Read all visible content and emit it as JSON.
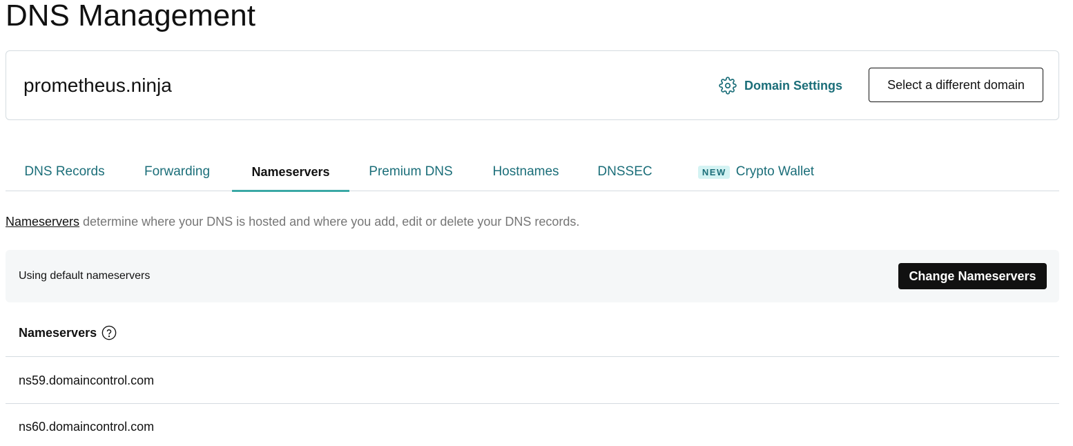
{
  "page": {
    "title": "DNS Management"
  },
  "domain_card": {
    "domain_name": "prometheus.ninja",
    "settings_label": "Domain Settings",
    "settings_icon": "gear-icon",
    "select_domain_label": "Select a different domain"
  },
  "tabs": [
    {
      "label": "DNS Records",
      "active": false
    },
    {
      "label": "Forwarding",
      "active": false
    },
    {
      "label": "Nameservers",
      "active": true
    },
    {
      "label": "Premium DNS",
      "active": false
    },
    {
      "label": "Hostnames",
      "active": false
    },
    {
      "label": "DNSSEC",
      "active": false
    },
    {
      "label": "Crypto Wallet",
      "badge": "NEW",
      "active": false
    }
  ],
  "description": {
    "link_text": "Nameservers",
    "text": " determine where your DNS is hosted and where you add, edit or delete your DNS records."
  },
  "status": {
    "text": "Using default nameservers",
    "button_label": "Change Nameservers"
  },
  "nameservers": {
    "header": "Nameservers",
    "help_icon": "help-icon",
    "list": [
      "ns59.domaincontrol.com",
      "ns60.domaincontrol.com"
    ]
  },
  "colors": {
    "accent_teal": "#1b6e79",
    "tab_underline": "#3aa8a5",
    "badge_bg": "#d4f3f3",
    "primary_button": "#111111",
    "status_bg": "#f5f7f8"
  }
}
